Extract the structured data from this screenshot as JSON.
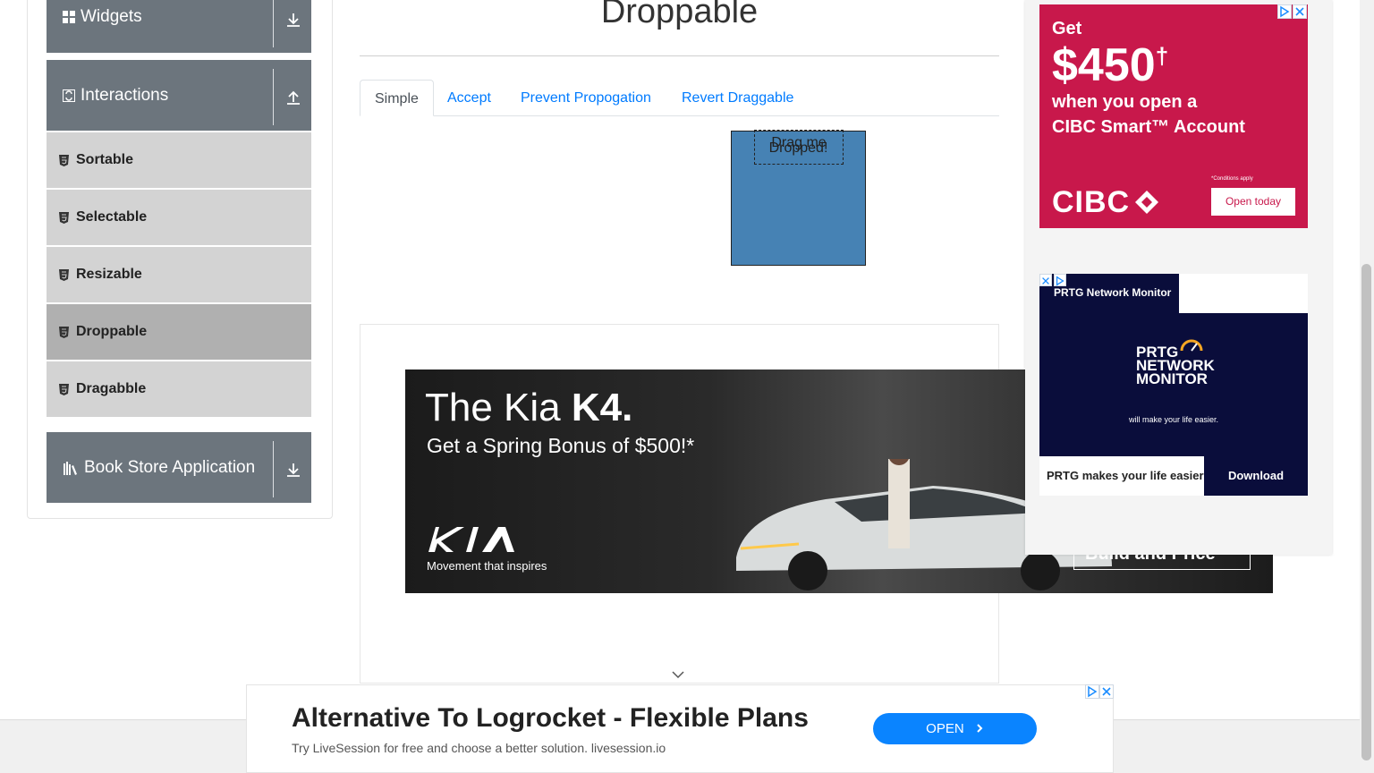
{
  "sidebar": {
    "groups": {
      "widgets": {
        "label": "Widgets"
      },
      "interactions": {
        "label": "Interactions"
      },
      "book_store": {
        "label": "Book Store Application"
      }
    },
    "items": [
      {
        "label": "Sortable"
      },
      {
        "label": "Selectable"
      },
      {
        "label": "Resizable"
      },
      {
        "label": "Droppable"
      },
      {
        "label": "Dragabble"
      }
    ]
  },
  "main": {
    "title": "Droppable",
    "tabs": [
      {
        "label": "Simple"
      },
      {
        "label": "Accept"
      },
      {
        "label": "Prevent Propogation"
      },
      {
        "label": "Revert Draggable"
      }
    ],
    "drop_text": "Dropped!",
    "drag_text": "Drag me"
  },
  "ads": {
    "kia": {
      "headline_light": "The Kia ",
      "headline_bold": "K4.",
      "sub": "Get a Spring Bonus of $500!*",
      "tagline": "Movement that inspires",
      "build": "Build and Price"
    },
    "cibc": {
      "get": "Get",
      "amount": "$450",
      "dagger": "†",
      "line1": "when you open a",
      "line2": "CIBC Smart™ Account",
      "conditions": "*Conditions apply",
      "brand": "CIBC",
      "button": "Open today"
    },
    "prtg": {
      "tab": "PRTG Network Monitor",
      "logo": "PRTG NETWORK MONITOR",
      "small": "will make your life easier.",
      "footer": "PRTG makes your life easier",
      "button": "Download"
    },
    "bottom": {
      "headline": "Alternative To Logrocket - Flexible Plans",
      "sub": "Try LiveSession for free and choose a better solution. livesession.io",
      "button": "OPEN"
    }
  },
  "colors": {
    "sidebar_header": "#6c757d",
    "sidebar_item": "#d3d3d3",
    "sidebar_item_active": "#b0b0b0",
    "link": "#007bff",
    "drop_box": "#4682b4",
    "cibc": "#c8184b",
    "prtg": "#0a0d3b"
  }
}
